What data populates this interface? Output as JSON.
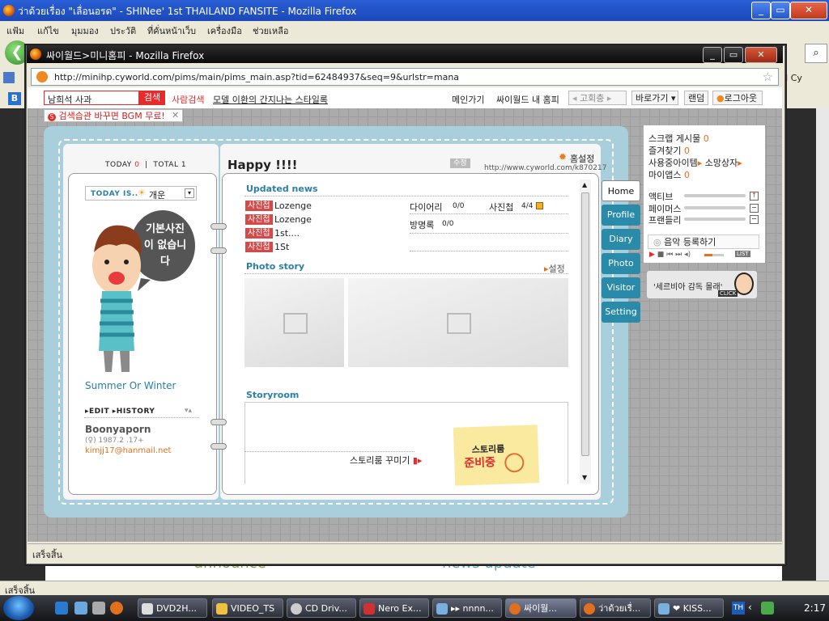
{
  "outer_window": {
    "title": "ว่าด้วยเรื่อง \"เลื่อนอรด\" - SHINee' 1st THAILAND FANSITE - Mozilla Firefox",
    "menu": [
      "แฟ้ม",
      "แก้ไข",
      "มุมมอง",
      "ประวัติ",
      "ที่คั่นหน้าเว็บ",
      "เครื่องมือ",
      "ช่วยเหลือ"
    ],
    "bookmark_fragment": "J Cy",
    "status": "เสร็จสิ้น"
  },
  "popup": {
    "title": "싸이월드>미니홈피 - Mozilla Firefox",
    "url": "http://minihp.cyworld.com/pims/main/pims_main.asp?tid=62484937&seq=9&urlstr=mana",
    "status": "เสร็จสิ้น"
  },
  "cy_topbar": {
    "search_value": "남희석 사과",
    "search_button": "검색",
    "people_search": "사람검색",
    "promo_link": "모델 이환의 간지나는 스타일록",
    "main_go": "메인가기",
    "my_homepage": "싸이월드 내 홈피",
    "rotate": "고회충",
    "goto": "바로가기",
    "random": "랜덤",
    "logout": "로그아웃",
    "bgm_banner": "검색습관 바꾸면 BGM 무료!"
  },
  "profile": {
    "today_label": "TODAY",
    "today_value": "0",
    "total_label": "TOTAL",
    "total_value": "1",
    "today_is_label": "TODAY IS..",
    "mood": "개운",
    "speech": "기본사진이 없습니다",
    "caption": "Summer Or Winter",
    "edit": "EDIT",
    "history": "HISTORY",
    "name": "Boonyaporn",
    "gender_birth": "(♀) 1987.2 .17+",
    "email": "kimjj17@hanmail.net"
  },
  "home": {
    "title": "Happy !!!!",
    "edit_badge": "수정",
    "settings": "홈설정",
    "homepage_url": "http://www.cyworld.com/k870217",
    "updated_news_title": "Updated news",
    "news": [
      {
        "tag": "사진첩",
        "text": "Lozenge"
      },
      {
        "tag": "사진첩",
        "text": "Lozenge"
      },
      {
        "tag": "사진첩",
        "text": "1st...."
      },
      {
        "tag": "사진첩",
        "text": "1St"
      }
    ],
    "counts": [
      {
        "label": "다이어리",
        "value": "0/0"
      },
      {
        "label": "사진첩",
        "value": "4/4"
      },
      {
        "label": "방명록",
        "value": "0/0"
      }
    ],
    "photo_story_title": "Photo story",
    "photo_story_setting": "설정",
    "storyroom_title": "Storyroom",
    "storyroom_decorate": "스토리룸 꾸미기",
    "storyroom_note_line1": "스토리룸",
    "storyroom_note_line2": "준비중"
  },
  "tabs": [
    "Home",
    "Profile",
    "Diary",
    "Photo",
    "Visitor",
    "Setting"
  ],
  "side": {
    "scrap_label": "스크랩 게시물",
    "scrap_value": "0",
    "fav_label": "즐겨찾기",
    "fav_value": "0",
    "items_label": "사용중아이템",
    "shop_label": "소망상자",
    "my_apps_label": "마이앱스",
    "my_apps_value": "0",
    "stats": [
      {
        "label": "액티브",
        "level": 0,
        "btn": "↑"
      },
      {
        "label": "페이머스",
        "level": 0,
        "btn": "−"
      },
      {
        "label": "프랜들리",
        "level": 0,
        "btn": "−"
      }
    ],
    "music_label": "음악 등록하기",
    "music_list": "LIST",
    "ad_text": "'세르비아 감독 몰래'",
    "ad_click": "CLICK"
  },
  "background_page": {
    "left_heading": "announce",
    "right_heading": "news update"
  },
  "taskbar": {
    "items": [
      "DVD2H...",
      "VIDEO_TS",
      "CD Driv...",
      "Nero Ex...",
      "▸▸ nnnn...",
      "싸이월...",
      "ว่าด้วยเรื่...",
      "❤ KISS..."
    ],
    "lang": "TH",
    "clock": "2:17"
  }
}
